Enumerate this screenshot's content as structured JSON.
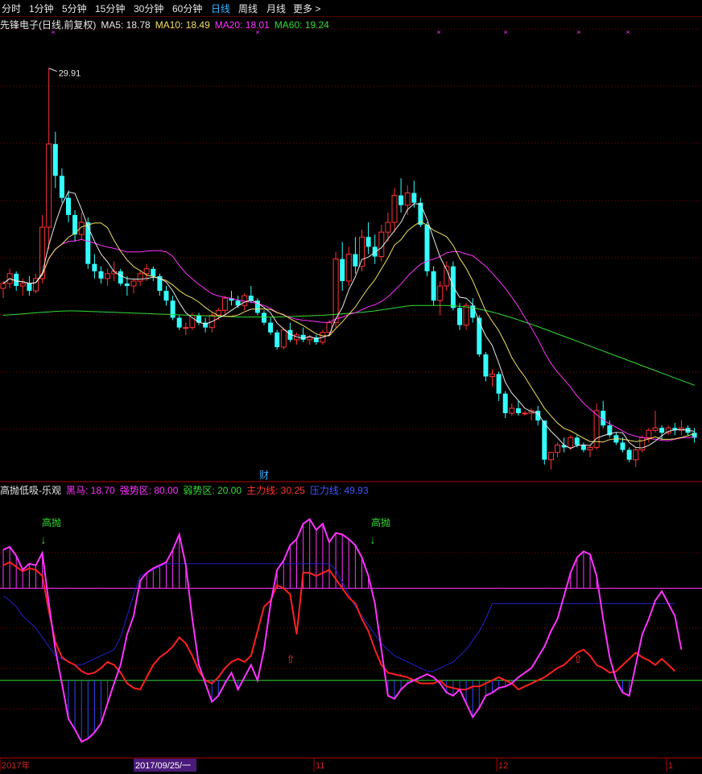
{
  "toolbar": {
    "items": [
      "分时",
      "1分钟",
      "5分钟",
      "15分钟",
      "30分钟",
      "60分钟",
      "日线",
      "周线",
      "月线",
      "更多 >"
    ],
    "active": "日线"
  },
  "main_legend": {
    "title": "先锋电子(日线,前复权)",
    "ma5": "MA5: 18.78",
    "ma10": "MA10: 18.49",
    "ma20": "MA20: 18.01",
    "ma60": "MA60: 19.24"
  },
  "peak_label": "29.91",
  "cai_label": "财",
  "indicator_legend": {
    "name": "高抛低吸-乐观",
    "heima": "黑马: 18.70",
    "qiang": "强势区: 80.00",
    "ruo": "弱势区: 20.00",
    "zhuli": "主力线: 30.25",
    "yali": "压力线: 49.93"
  },
  "signal_labels": [
    "高抛",
    "高抛"
  ],
  "x_axis": {
    "labels": [
      "2017年",
      "2017/09/25/一",
      "11",
      "12",
      "1"
    ]
  },
  "colors": {
    "up": "#ff3333",
    "down": "#33ffff",
    "ma5": "#e8e8e8",
    "ma10": "#f0e060",
    "ma20": "#ff33ff",
    "ma60": "#33dd33",
    "heima": "#ff33ff",
    "zhuli": "#ff2020",
    "yali": "#2222cc",
    "grid": "#8b0000"
  },
  "chart_data": {
    "type": "candlestick",
    "price_range": [
      13.2,
      31.5
    ],
    "candles": [
      [
        20.9,
        21.2,
        20.5,
        21.1
      ],
      [
        21.1,
        21.7,
        20.9,
        21.5
      ],
      [
        21.5,
        21.6,
        20.8,
        21.0
      ],
      [
        21.0,
        21.3,
        20.6,
        21.1
      ],
      [
        21.1,
        21.4,
        20.6,
        20.8
      ],
      [
        20.8,
        21.5,
        20.7,
        21.3
      ],
      [
        21.3,
        23.9,
        21.1,
        23.4
      ],
      [
        23.4,
        29.9,
        22.5,
        26.8
      ],
      [
        26.8,
        27.3,
        25.0,
        25.5
      ],
      [
        25.5,
        25.8,
        24.4,
        24.6
      ],
      [
        24.6,
        24.9,
        23.6,
        23.9
      ],
      [
        23.9,
        24.1,
        22.8,
        23.1
      ],
      [
        23.1,
        24.0,
        22.9,
        23.6
      ],
      [
        23.6,
        23.8,
        21.7,
        21.9
      ],
      [
        21.9,
        22.3,
        21.3,
        21.6
      ],
      [
        21.6,
        21.8,
        21.1,
        21.3
      ],
      [
        21.3,
        21.7,
        21.0,
        21.5
      ],
      [
        21.5,
        22.0,
        21.2,
        21.6
      ],
      [
        21.6,
        21.7,
        21.0,
        21.1
      ],
      [
        21.1,
        21.4,
        20.6,
        21.0
      ],
      [
        21.0,
        21.3,
        20.7,
        21.2
      ],
      [
        21.2,
        21.6,
        21.0,
        21.5
      ],
      [
        21.5,
        21.9,
        21.2,
        21.7
      ],
      [
        21.7,
        21.8,
        21.2,
        21.4
      ],
      [
        21.4,
        21.5,
        20.6,
        20.8
      ],
      [
        20.8,
        21.0,
        20.2,
        20.4
      ],
      [
        20.4,
        20.6,
        19.6,
        19.7
      ],
      [
        19.7,
        19.8,
        19.2,
        19.3
      ],
      [
        19.3,
        19.5,
        19.0,
        19.3
      ],
      [
        19.3,
        19.9,
        19.2,
        19.8
      ],
      [
        19.8,
        19.9,
        19.4,
        19.5
      ],
      [
        19.5,
        19.7,
        19.1,
        19.3
      ],
      [
        19.3,
        19.9,
        19.1,
        19.8
      ],
      [
        19.8,
        20.1,
        19.6,
        20.0
      ],
      [
        20.0,
        20.6,
        19.8,
        20.5
      ],
      [
        20.5,
        20.8,
        20.2,
        20.4
      ],
      [
        20.4,
        20.6,
        20.1,
        20.2
      ],
      [
        20.2,
        20.7,
        20.0,
        20.6
      ],
      [
        20.6,
        21.0,
        20.3,
        20.4
      ],
      [
        20.4,
        20.5,
        19.8,
        19.9
      ],
      [
        19.9,
        20.0,
        19.4,
        19.5
      ],
      [
        19.5,
        19.7,
        19.0,
        19.1
      ],
      [
        19.1,
        19.2,
        18.4,
        18.5
      ],
      [
        18.5,
        19.3,
        18.4,
        19.2
      ],
      [
        19.2,
        19.5,
        18.7,
        18.8
      ],
      [
        18.8,
        19.1,
        18.6,
        19.0
      ],
      [
        19.0,
        19.3,
        18.7,
        18.8
      ],
      [
        18.8,
        19.0,
        18.6,
        18.9
      ],
      [
        18.9,
        19.0,
        18.6,
        18.7
      ],
      [
        18.7,
        19.2,
        18.6,
        19.1
      ],
      [
        19.1,
        19.6,
        19.0,
        19.5
      ],
      [
        19.5,
        22.4,
        19.3,
        22.1
      ],
      [
        22.1,
        22.8,
        20.8,
        21.2
      ],
      [
        21.2,
        22.6,
        21.0,
        22.3
      ],
      [
        22.3,
        23.0,
        21.5,
        21.8
      ],
      [
        21.8,
        23.3,
        21.6,
        23.0
      ],
      [
        23.0,
        23.6,
        22.3,
        22.6
      ],
      [
        22.6,
        23.1,
        21.9,
        22.2
      ],
      [
        22.2,
        23.5,
        22.0,
        23.2
      ],
      [
        23.2,
        24.0,
        22.8,
        23.6
      ],
      [
        23.6,
        25.0,
        23.2,
        24.7
      ],
      [
        24.7,
        25.4,
        24.0,
        24.3
      ],
      [
        24.3,
        25.1,
        23.9,
        24.8
      ],
      [
        24.8,
        25.3,
        24.2,
        24.4
      ],
      [
        24.4,
        24.6,
        23.4,
        23.5
      ],
      [
        23.5,
        23.6,
        21.4,
        21.6
      ],
      [
        21.6,
        21.8,
        20.2,
        20.4
      ],
      [
        20.4,
        21.2,
        19.8,
        21.0
      ],
      [
        21.0,
        22.0,
        20.8,
        21.8
      ],
      [
        21.8,
        22.0,
        20.0,
        20.1
      ],
      [
        20.1,
        20.3,
        19.2,
        19.4
      ],
      [
        19.4,
        20.3,
        19.2,
        20.2
      ],
      [
        20.2,
        20.5,
        19.5,
        19.7
      ],
      [
        19.7,
        19.8,
        18.1,
        18.2
      ],
      [
        18.2,
        18.3,
        17.1,
        17.3
      ],
      [
        17.3,
        17.6,
        16.9,
        17.4
      ],
      [
        17.4,
        17.5,
        16.3,
        16.6
      ],
      [
        16.6,
        16.7,
        15.6,
        15.8
      ],
      [
        15.8,
        16.2,
        15.7,
        16.0
      ],
      [
        16.0,
        16.3,
        15.7,
        15.8
      ],
      [
        15.8,
        15.9,
        15.7,
        15.8
      ],
      [
        15.8,
        16.0,
        15.5,
        15.9
      ],
      [
        15.9,
        16.1,
        15.3,
        15.5
      ],
      [
        15.5,
        15.5,
        13.7,
        13.9
      ],
      [
        13.9,
        14.2,
        13.5,
        14.2
      ],
      [
        14.2,
        14.6,
        14.0,
        14.5
      ],
      [
        14.5,
        14.8,
        14.2,
        14.4
      ],
      [
        14.4,
        14.9,
        14.3,
        14.8
      ],
      [
        14.8,
        14.9,
        14.4,
        14.5
      ],
      [
        14.5,
        14.6,
        14.2,
        14.3
      ],
      [
        14.3,
        14.5,
        14.0,
        14.4
      ],
      [
        14.4,
        16.2,
        14.3,
        15.9
      ],
      [
        15.9,
        16.3,
        15.2,
        15.3
      ],
      [
        15.3,
        15.5,
        14.8,
        14.9
      ],
      [
        14.9,
        15.0,
        14.5,
        14.6
      ],
      [
        14.6,
        14.8,
        14.2,
        14.3
      ],
      [
        14.3,
        14.4,
        13.8,
        13.9
      ],
      [
        13.9,
        14.4,
        13.6,
        14.3
      ],
      [
        14.3,
        14.9,
        14.2,
        14.8
      ],
      [
        14.8,
        15.2,
        14.6,
        15.1
      ],
      [
        15.1,
        15.9,
        15.0,
        15.2
      ],
      [
        15.2,
        15.3,
        14.7,
        15.0
      ],
      [
        15.0,
        15.3,
        14.9,
        15.2
      ],
      [
        15.2,
        15.4,
        14.9,
        15.1
      ],
      [
        15.1,
        15.5,
        14.9,
        15.2
      ],
      [
        15.2,
        15.3,
        14.9,
        15.0
      ],
      [
        15.0,
        15.2,
        14.6,
        14.8
      ]
    ],
    "ma60": [
      19.8,
      19.82,
      19.84,
      19.86,
      19.88,
      19.9,
      19.92,
      19.94,
      19.96,
      19.97,
      19.98,
      19.98,
      19.97,
      19.96,
      19.95,
      19.94,
      19.93,
      19.92,
      19.91,
      19.9,
      19.89,
      19.88,
      19.87,
      19.86,
      19.85,
      19.84,
      19.83,
      19.82,
      19.81,
      19.8,
      19.79,
      19.78,
      19.77,
      19.76,
      19.75,
      19.74,
      19.73,
      19.73,
      19.73,
      19.73,
      19.73,
      19.73,
      19.73,
      19.74,
      19.75,
      19.76,
      19.77,
      19.78,
      19.79,
      19.8,
      19.82,
      19.84,
      19.86,
      19.88,
      19.9,
      19.92,
      19.95,
      19.98,
      20.02,
      20.06,
      20.1,
      20.14,
      20.18,
      20.2,
      20.2,
      20.2,
      20.2,
      20.2,
      20.2,
      20.19,
      20.17,
      20.14,
      20.1,
      20.05,
      20.0,
      19.93,
      19.86,
      19.78,
      19.7,
      19.61,
      19.52,
      19.43,
      19.34,
      19.24,
      19.14,
      19.04,
      18.94,
      18.84,
      18.74,
      18.64,
      18.54,
      18.44,
      18.34,
      18.24,
      18.14,
      18.04,
      17.94,
      17.84,
      17.74,
      17.64,
      17.54,
      17.44,
      17.34,
      17.24,
      17.14,
      17.04,
      16.94
    ],
    "indicator": {
      "y_range": [
        -30,
        140
      ],
      "strong_level": 80.0,
      "weak_level": 20.0,
      "heima": [
        105,
        107,
        101,
        92,
        96,
        95,
        103,
        70,
        40,
        18,
        -5,
        -12,
        -20,
        -18,
        -14,
        -8,
        5,
        18,
        30,
        50,
        62,
        85,
        90,
        93,
        95,
        97,
        105,
        115,
        95,
        60,
        30,
        18,
        6,
        10,
        18,
        25,
        14,
        22,
        30,
        20,
        40,
        70,
        92,
        98,
        108,
        112,
        122,
        125,
        118,
        122,
        110,
        116,
        115,
        112,
        108,
        100,
        88,
        70,
        40,
        10,
        8,
        14,
        18,
        20,
        22,
        24,
        22,
        18,
        12,
        10,
        14,
        5,
        -4,
        2,
        10,
        12,
        15,
        16,
        18,
        22,
        25,
        28,
        35,
        42,
        52,
        60,
        75,
        90,
        100,
        104,
        102,
        88,
        60,
        35,
        20,
        12,
        10,
        30,
        50,
        60,
        72,
        78,
        70,
        62,
        40
      ],
      "zhuli": [
        95,
        97,
        94,
        91,
        93,
        92,
        88,
        65,
        45,
        35,
        32,
        30,
        26,
        24,
        25,
        28,
        32,
        30,
        25,
        18,
        15,
        14,
        22,
        30,
        35,
        38,
        42,
        48,
        44,
        36,
        26,
        20,
        18,
        22,
        28,
        32,
        34,
        32,
        36,
        52,
        68,
        72,
        82,
        80,
        76,
        50,
        90,
        90,
        88,
        90,
        92,
        86,
        80,
        74,
        70,
        60,
        52,
        40,
        30,
        25,
        24,
        23,
        22,
        20,
        18,
        18,
        18,
        20,
        16,
        15,
        14,
        14,
        16,
        16,
        18,
        20,
        22,
        20,
        18,
        14,
        16,
        18,
        20,
        22,
        25,
        28,
        30,
        34,
        38,
        40,
        36,
        30,
        28,
        25,
        26,
        30,
        34,
        38,
        35,
        33,
        30,
        34,
        30,
        26
      ],
      "yali": [
        75,
        72,
        68,
        62,
        58,
        54,
        48,
        42,
        36,
        34,
        32,
        30,
        30,
        32,
        34,
        36,
        38,
        40,
        48,
        62,
        76,
        88,
        90,
        92,
        94,
        96,
        96,
        96,
        96,
        96,
        96,
        96,
        96,
        96,
        96,
        96,
        96,
        96,
        96,
        96,
        96,
        96,
        96,
        96,
        96,
        96,
        96,
        96,
        96,
        96,
        96,
        92,
        84,
        76,
        68,
        62,
        56,
        50,
        44,
        40,
        36,
        34,
        32,
        30,
        28,
        26,
        26,
        28,
        30,
        32,
        36,
        40,
        46,
        52,
        60,
        70,
        70,
        70,
        70,
        70,
        70,
        70,
        70,
        70,
        70,
        70,
        70,
        70,
        70,
        70,
        70,
        70,
        70,
        70,
        70,
        70,
        70,
        70,
        70,
        70,
        70,
        70,
        70,
        70
      ]
    }
  }
}
